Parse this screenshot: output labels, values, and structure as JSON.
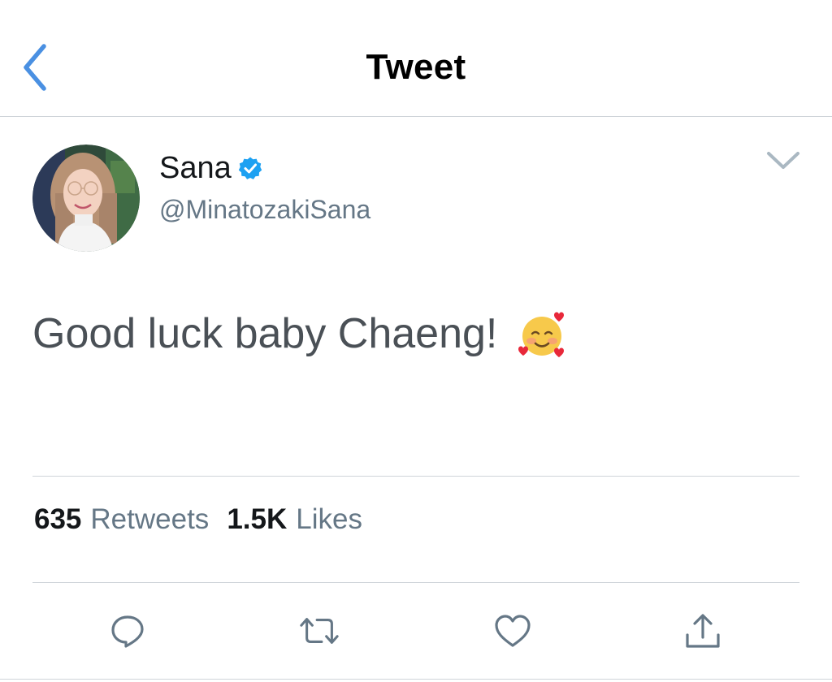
{
  "header": {
    "title": "Tweet",
    "back_icon": "chevron-left-icon",
    "accent_color": "#4a90e2"
  },
  "author": {
    "name": "Sana",
    "handle": "@MinatozakiSana",
    "verified": true,
    "verified_color": "#1da1f2",
    "avatar_icon": "profile-photo"
  },
  "tweet": {
    "text": "Good luck baby Chaeng!",
    "emoji": "smiling-face-with-hearts"
  },
  "stats": {
    "retweets_count": "635",
    "retweets_label": "Retweets",
    "likes_count": "1.5K",
    "likes_label": "Likes"
  },
  "actions": [
    "reply-icon",
    "retweet-icon",
    "like-icon",
    "share-icon"
  ],
  "colors": {
    "text_primary": "#14171a",
    "text_secondary": "#657786",
    "divider": "#cfd4d9"
  }
}
